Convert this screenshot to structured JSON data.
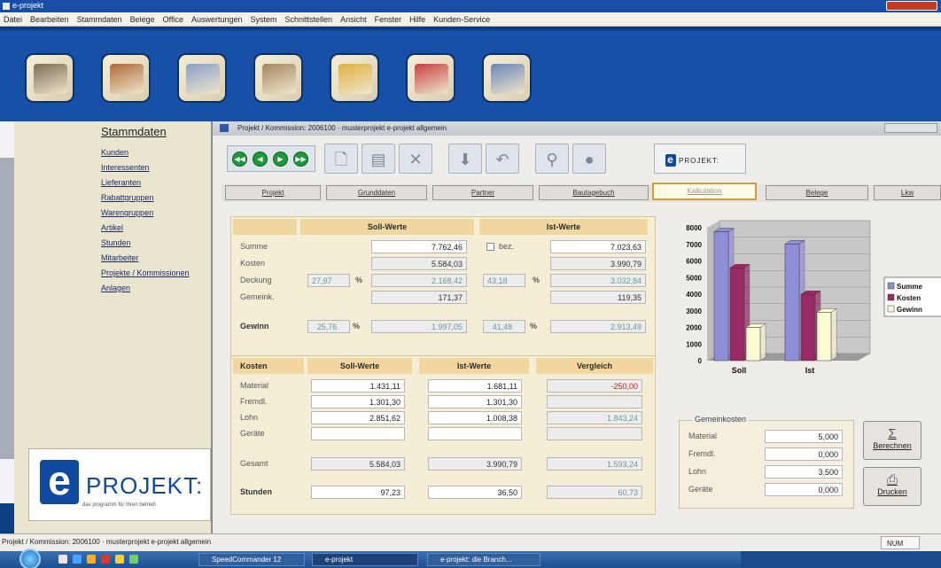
{
  "app": {
    "title": "e-projekt"
  },
  "menu": [
    "Datei",
    "Bearbeiten",
    "Stammdaten",
    "Belege",
    "Office",
    "Auswertungen",
    "System",
    "Schnittstellen",
    "Ansicht",
    "Fenster",
    "Hilfe",
    "Kunden-Service"
  ],
  "toolbar_icons": [
    "stammdaten-icon",
    "belege-icon",
    "office-icon",
    "projekte-icon",
    "auswertungen-icon",
    "planung-icon",
    "system-icon"
  ],
  "nav": {
    "title": "Stammdaten",
    "items": [
      "Kunden",
      "Interessenten",
      "Lieferanten",
      "Rabattgruppen",
      "Warengruppen",
      "Artikel",
      "Stunden",
      "Mitarbeiter",
      "Projekte / Kommissionen",
      "Anlagen"
    ]
  },
  "logo": {
    "letter": "e",
    "name": "PROJEKT:",
    "slogan": "das programm für Ihren betrieb"
  },
  "window": {
    "title": "Projekt / Kommission: 2006100 · musterprojekt e-projekt allgemein",
    "brand_letter": "e",
    "brand_text": "PROJEKT:"
  },
  "tabs": [
    "Projekt",
    "Grunddaten",
    "Partner",
    "Bautagebuch",
    "Kalkulation",
    "Belege",
    "Lkw"
  ],
  "summary": {
    "col_soll": "Soll-Werte",
    "col_ist": "Ist-Werte",
    "rows": [
      "Summe",
      "Kosten",
      "Deckung",
      "Gemeink."
    ],
    "gewinn_label": "Gewinn",
    "bez_label": "bez.",
    "soll": {
      "summe": "7.762,46",
      "kosten": "5.584,03",
      "deckung_pct": "27,97",
      "deckung": "2.168,42",
      "gemeink": "171,37",
      "gewinn_pct": "25,76",
      "gewinn": "1.997,05"
    },
    "ist": {
      "summe": "7.023,63",
      "kosten": "3.990,79",
      "deckung_pct": "43,18",
      "deckung": "3.032,84",
      "gemeink": "119,35",
      "gewinn_pct": "41,48",
      "gewinn": "2.913,49"
    }
  },
  "costs": {
    "headers": [
      "Kosten",
      "Soll-Werte",
      "Ist-Werte",
      "Vergleich"
    ],
    "rows": [
      {
        "label": "Material",
        "soll": "1.431,11",
        "ist": "1.681,11",
        "vgl": "-250,00"
      },
      {
        "label": "Fremdl.",
        "soll": "1.301,30",
        "ist": "1.301,30",
        "vgl": ""
      },
      {
        "label": "Lohn",
        "soll": "2.851,62",
        "ist": "1.008,38",
        "vgl": "1.843,24"
      },
      {
        "label": "Geräte",
        "soll": "",
        "ist": "",
        "vgl": ""
      }
    ],
    "gesamt": {
      "label": "Gesamt",
      "soll": "5.584,03",
      "ist": "3.990,79",
      "vgl": "1.593,24"
    },
    "stunden": {
      "label": "Stunden",
      "soll": "97,23",
      "ist": "36,50",
      "vgl": "60,73"
    }
  },
  "chart_data": {
    "type": "bar",
    "categories": [
      "Soll",
      "Ist"
    ],
    "series": [
      {
        "name": "Summe",
        "values": [
          7762.46,
          7023.63
        ],
        "color": "#8f8fd8"
      },
      {
        "name": "Kosten",
        "values": [
          5584.03,
          3990.79
        ],
        "color": "#9a2a66"
      },
      {
        "name": "Gewinn",
        "values": [
          1997.05,
          2913.49
        ],
        "color": "#fdfbd3"
      }
    ],
    "yticks": [
      "8000",
      "7000",
      "6000",
      "5000",
      "4000",
      "3000",
      "2000",
      "1000",
      "0"
    ],
    "ylim": [
      0,
      8000
    ],
    "legend": "right",
    "grid": true
  },
  "gemein": {
    "title": "Gemeinkosten",
    "rows": [
      {
        "label": "Material",
        "value": "5,000"
      },
      {
        "label": "Fremdl.",
        "value": "0,000"
      },
      {
        "label": "Lohn",
        "value": "3,500"
      },
      {
        "label": "Geräte",
        "value": "0,000"
      }
    ]
  },
  "buttons": {
    "berechnen": "Berechnen",
    "drucken": "Drucken"
  },
  "status": {
    "text": "Projekt / Kommission: 2006100 · musterprojekt e-projekt allgemein",
    "right": "NUM"
  },
  "taskbar": {
    "items": [
      "SpeedCommander 12",
      "e-projekt",
      "e-projekt: die Branch..."
    ]
  }
}
